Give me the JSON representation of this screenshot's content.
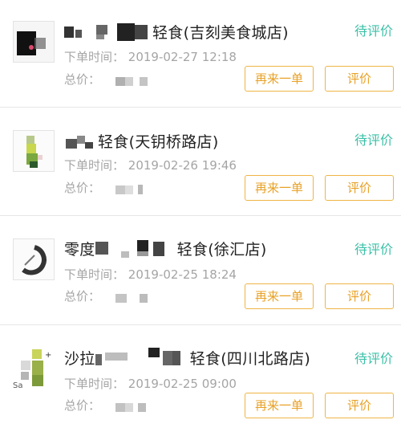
{
  "orders": [
    {
      "store_name_tail": "轻食(吉刻美食城店)",
      "status": "待评价",
      "order_time_label": "下单时间：",
      "order_time": "2019-02-27 12:18",
      "total_label": "总价：",
      "reorder_label": "再来一单",
      "review_label": "评价"
    },
    {
      "store_name_tail": "轻食(天钥桥路店)",
      "status": "待评价",
      "order_time_label": "下单时间：",
      "order_time": "2019-02-26 19:46",
      "total_label": "总价：",
      "reorder_label": "再来一单",
      "review_label": "评价"
    },
    {
      "store_name_head": "零度",
      "store_name_tail": "轻食(徐汇店)",
      "status": "待评价",
      "order_time_label": "下单时间：",
      "order_time": "2019-02-25 18:24",
      "total_label": "总价：",
      "reorder_label": "再来一单",
      "review_label": "评价"
    },
    {
      "store_name_head": "沙拉",
      "store_name_tail": "轻食(四川北路店)",
      "status": "待评价",
      "order_time_label": "下单时间：",
      "order_time": "2019-02-25 09:00",
      "total_label": "总价：",
      "reorder_label": "再来一单",
      "review_label": "评价"
    }
  ],
  "colors": {
    "status_teal": "#3cc1a8",
    "button_orange": "#e8a126",
    "meta_gray": "#a5a5a5",
    "divider": "#e6e6e6"
  }
}
